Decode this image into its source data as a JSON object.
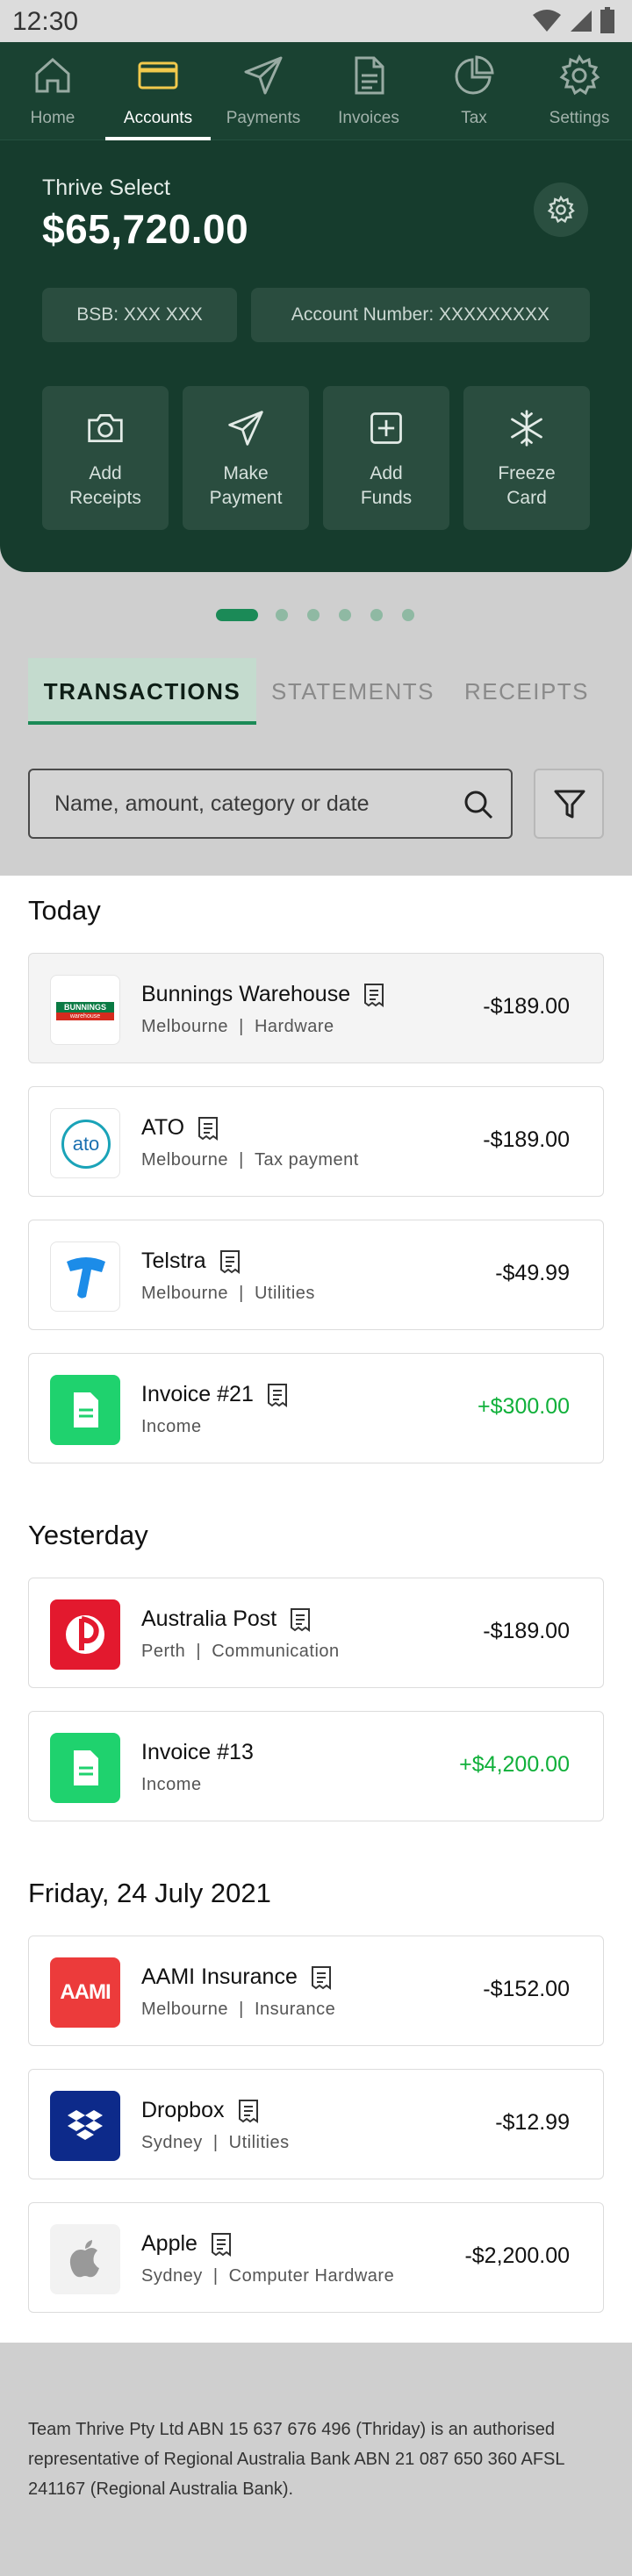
{
  "status_bar": {
    "time": "12:30"
  },
  "nav": {
    "items": [
      {
        "label": "Home",
        "icon": "home-icon"
      },
      {
        "label": "Accounts",
        "icon": "card-icon",
        "active": true
      },
      {
        "label": "Payments",
        "icon": "send-icon"
      },
      {
        "label": "Invoices",
        "icon": "document-icon"
      },
      {
        "label": "Tax",
        "icon": "pie-chart-icon"
      },
      {
        "label": "Settings",
        "icon": "gear-icon"
      }
    ]
  },
  "account": {
    "name": "Thrive Select",
    "balance": "$65,720.00",
    "bsb": "BSB: XXX XXX",
    "account_number": "Account Number: XXXXXXXXX"
  },
  "actions": [
    {
      "label": "Add\nReceipts",
      "icon": "camera-icon"
    },
    {
      "label": "Make\nPayment",
      "icon": "send-icon"
    },
    {
      "label": "Add\nFunds",
      "icon": "plus-square-icon"
    },
    {
      "label": "Freeze\nCard",
      "icon": "snowflake-icon"
    }
  ],
  "carousel": {
    "count": 6,
    "active_index": 0
  },
  "tabs": [
    {
      "label": "TRANSACTIONS",
      "active": true
    },
    {
      "label": "STATEMENTS"
    },
    {
      "label": "RECEIPTS"
    }
  ],
  "search": {
    "placeholder": "Name, amount, category or date"
  },
  "sections": [
    {
      "title": "Today",
      "transactions": [
        {
          "name": "Bunnings Warehouse",
          "location": "Melbourne",
          "category": "Hardware",
          "amount": "-$189.00",
          "logo": "bunnings"
        },
        {
          "name": "ATO",
          "location": "Melbourne",
          "category": "Tax payment",
          "amount": "-$189.00",
          "logo": "ato"
        },
        {
          "name": "Telstra",
          "location": "Melbourne",
          "category": "Utilities",
          "amount": "-$49.99",
          "logo": "telstra"
        },
        {
          "name": "Invoice #21",
          "location": "",
          "category": "Income",
          "amount": "+$300.00",
          "logo": "invoice"
        }
      ]
    },
    {
      "title": "Yesterday",
      "transactions": [
        {
          "name": "Australia Post",
          "location": "Perth",
          "category": "Communication",
          "amount": "-$189.00",
          "logo": "auspost"
        },
        {
          "name": "Invoice #13",
          "location": "",
          "category": "Income",
          "amount": "+$4,200.00",
          "logo": "invoice"
        }
      ]
    },
    {
      "title": "Friday, 24 July 2021",
      "transactions": [
        {
          "name": "AAMI Insurance",
          "location": "Melbourne",
          "category": "Insurance",
          "amount": "-$152.00",
          "logo": "aami"
        },
        {
          "name": "Dropbox",
          "location": "Sydney",
          "category": "Utilities",
          "amount": "-$12.99",
          "logo": "dropbox"
        },
        {
          "name": "Apple",
          "location": "Sydney",
          "category": "Computer Hardware",
          "amount": "-$2,200.00",
          "logo": "apple"
        }
      ]
    }
  ],
  "logo_text": {
    "bunnings": "BUNNINGS",
    "bunnings_sub": "warehouse",
    "ato": "ato",
    "aami": "AAMI"
  },
  "footer": {
    "disclaimer": "Team Thrive Pty Ltd ABN 15 637 676 496 (Thriday) is an authorised representative of Regional Australia Bank ABN 21 087 650 360 AFSL 241167 (Regional Australia Bank)."
  },
  "colors": {
    "brand_dark": "#163c2d",
    "accent": "#1b8a57",
    "positive": "#10b03a"
  }
}
